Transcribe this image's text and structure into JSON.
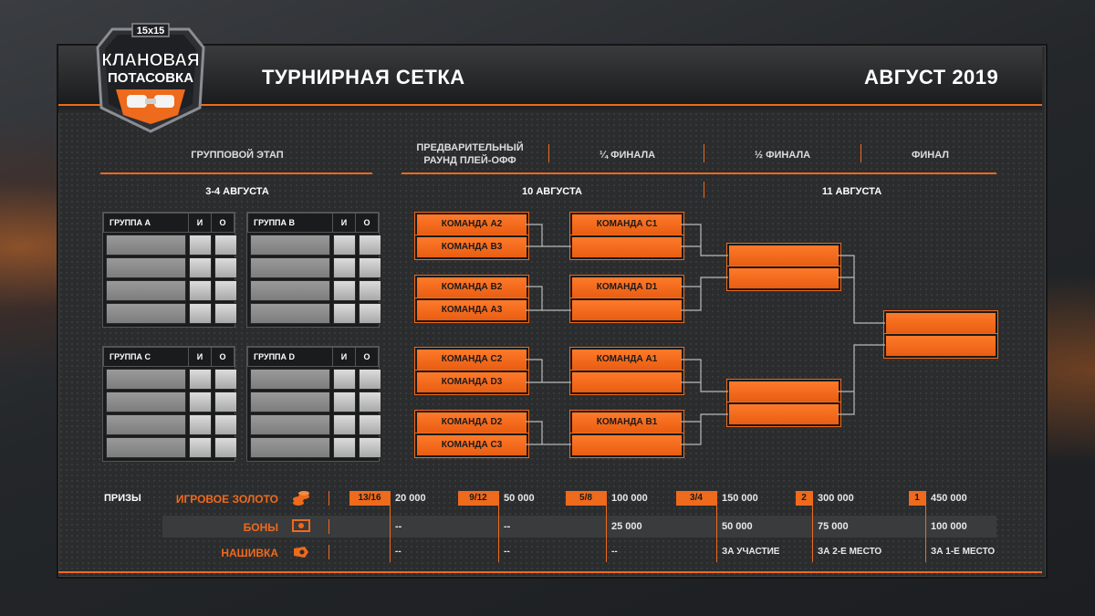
{
  "header": {
    "title": "ТУРНИРНАЯ СЕТКА",
    "month": "АВГУСТ  2019"
  },
  "logo": {
    "size": "15x15",
    "line1": "КЛАНОВАЯ",
    "line2": "ПОТАСОВКА"
  },
  "columns": {
    "group_stage": "ГРУППОВОЙ ЭТАП",
    "prelim_line1": "ПРЕДВАРИТЕЛЬНЫЙ",
    "prelim_line2": "РАУНД ПЛЕЙ-ОФФ",
    "quarter": "¼ ФИНАЛА",
    "semi": "½ ФИНАЛА",
    "final": "ФИНАЛ"
  },
  "dates": {
    "groups": "3-4 АВГУСТА",
    "day1": "10 АВГУСТА",
    "day2": "11 АВГУСТА"
  },
  "groups": [
    {
      "name": "ГРУППА A",
      "col1": "И",
      "col2": "О"
    },
    {
      "name": "ГРУППА B",
      "col1": "И",
      "col2": "О"
    },
    {
      "name": "ГРУППА C",
      "col1": "И",
      "col2": "О"
    },
    {
      "name": "ГРУППА D",
      "col1": "И",
      "col2": "О"
    }
  ],
  "prelim": [
    [
      "КОМАНДА A2",
      "КОМАНДА B3"
    ],
    [
      "КОМАНДА B2",
      "КОМАНДА A3"
    ],
    [
      "КОМАНДА C2",
      "КОМАНДА D3"
    ],
    [
      "КОМАНДА D2",
      "КОМАНДА C3"
    ]
  ],
  "quarter": [
    [
      "КОМАНДА C1",
      ""
    ],
    [
      "КОМАНДА D1",
      ""
    ],
    [
      "КОМАНДА A1",
      ""
    ],
    [
      "КОМАНДА B1",
      ""
    ]
  ],
  "prizes": {
    "label": "ПРИЗЫ",
    "rows": [
      "ИГРОВОЕ ЗОЛОТО",
      "БОНЫ",
      "НАШИВКА"
    ],
    "places": [
      {
        "tag": "13/16",
        "gold": "20 000",
        "bonds": "--",
        "patch": "--"
      },
      {
        "tag": "9/12",
        "gold": "50 000",
        "bonds": "--",
        "patch": "--"
      },
      {
        "tag": "5/8",
        "gold": "100 000",
        "bonds": "25 000",
        "patch": "--"
      },
      {
        "tag": "3/4",
        "gold": "150 000",
        "bonds": "50 000",
        "patch": "ЗА УЧАСТИЕ"
      },
      {
        "tag": "2",
        "gold": "300 000",
        "bonds": "75 000",
        "patch": "ЗА 2-Е МЕСТО"
      },
      {
        "tag": "1",
        "gold": "450 000",
        "bonds": "100 000",
        "patch": "ЗА 1-Е МЕСТО"
      }
    ]
  },
  "colors": {
    "accent": "#ee6a1c",
    "panel": "#2b2c2e"
  }
}
